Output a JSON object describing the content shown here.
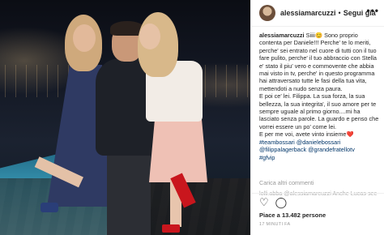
{
  "post": {
    "username": "alessiamarcuzzi",
    "follow_label": "Segui già",
    "dot": "•",
    "more_icon": "•••"
  },
  "caption": {
    "username": "alessiamarcuzzi",
    "text_1": "Siiii😊 Sono proprio contenta per Daniele!!! Perche' te lo meriti, perche' sei entrato nel cuore di tutti con il tuo fare pulito, perche' il tuo abbraccio con Stella e' stato il piu' vero e commovente che abbia mai visto in tv, perche' in questo programma hai attraversato tutte le fasi della tua vita, mettendoti a nudo senza paura.",
    "text_2": "E poi ce' lei. Filippa. La sua forza, la sua bellezza, la sua integrita', il suo amore per te sempre uguale al primo giorno....mi ha lasciato senza parole. La guardo e penso che vorrei essere un po' come lei.",
    "text_3": "E per me voi, avete vinto insieme❤️",
    "hashtags_1": "#teambossari @danielebossari",
    "hashtags_2": "@filippalagerback @grandefratellotv",
    "hashtags_3": "#gfvip"
  },
  "comments": {
    "load_more": "Carica altri commenti",
    "partial": "lolli.abba @alessiamarcuzzi Anche Lucas sec"
  },
  "actions": {
    "like_icon": "♡",
    "comment_icon": "◯"
  },
  "likes": "Piace a 13.482 persone",
  "timestamp": "17 MINUTI FA"
}
